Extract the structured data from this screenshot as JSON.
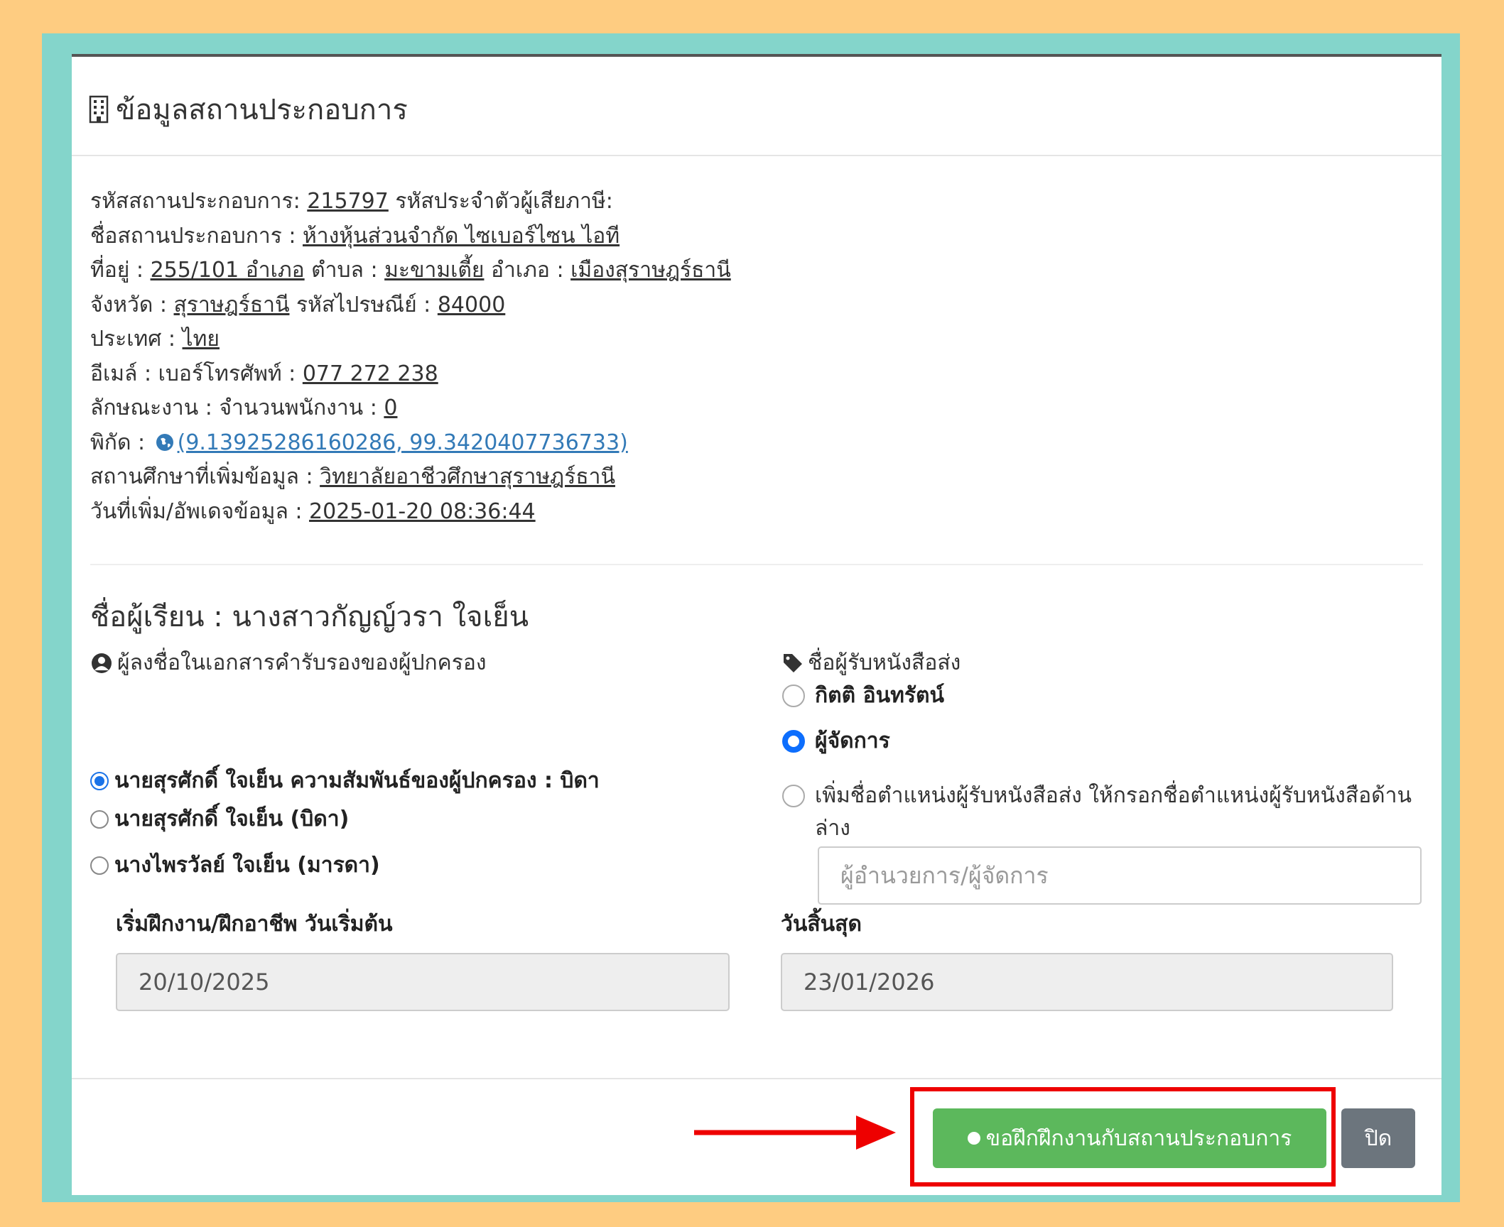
{
  "modal": {
    "title": "ข้อมูลสถานประกอบการ",
    "info": {
      "code_label": "รหัสสถานประกอบการ: ",
      "code_value": "215797",
      "tax_label": " รหัสประจำตัวผู้เสียภาษี:",
      "name_label": "ชื่อสถานประกอบการ : ",
      "name_value": "ห้างหุ้นส่วนจำกัด ไซเบอร์ไซน ไอที",
      "address_label": "ที่อยู่ : ",
      "address_value": "255/101 อำเภอ",
      "subdistrict_label": " ตำบล : ",
      "subdistrict_value": "มะขามเตี้ย",
      "district_label": " อำเภอ : ",
      "district_value": "เมืองสุราษฎร์ธานี",
      "province_label": "จังหวัด : ",
      "province_value": "สุราษฎร์ธานี",
      "postal_label": " รหัสไปรษณีย์ : ",
      "postal_value": "84000",
      "country_label": "ประเทศ : ",
      "country_value": "ไทย",
      "email_label": "อีเมล์ : ",
      "phone_label": "เบอร์โทรศัพท์ : ",
      "phone_value": "077 272 238",
      "nature_label": "ลักษณะงาน : ",
      "employees_label": "จำนวนพนักงาน : ",
      "employees_value": "0",
      "coords_label": "พิกัด : ",
      "coords_value": "(9.13925286160286, 99.3420407736733)",
      "school_label": "สถานศึกษาที่เพิ่มข้อมูล : ",
      "school_value": "วิทยาลัยอาชีวศึกษาสุราษฎร์ธานี",
      "updated_label": "วันที่เพิ่ม/อัพเดจข้อมูล : ",
      "updated_value": "2025-01-20 08:36:44"
    },
    "student": "ชื่อผู้เรียน : นางสาวกัญญ์วรา ใจเย็น",
    "guardian": {
      "label": "ผู้ลงชื่อในเอกสารคำรับรองของผู้ปกครอง",
      "options": [
        "นายสุรศักดิ์ ใจเย็น ความสัมพันธ์ของผู้ปกครอง : บิดา",
        "นายสุรศักดิ์ ใจเย็น (บิดา)",
        "นางไพรวัลย์ ใจเย็น (มารดา)"
      ],
      "selected": 0
    },
    "recipient": {
      "label": "ชื่อผู้รับหนังสือส่ง",
      "options": [
        "กิตติ อินทรัตน์",
        "ผู้จัดการ",
        "เพิ่มชื่อตำแหน่งผู้รับหนังสือส่ง ให้กรอกชื่อตำแหน่งผู้รับหนังสือด้านล่าง"
      ],
      "selected": 1,
      "placeholder": "ผู้อำนวยการ/ผู้จัดการ"
    },
    "start": {
      "label": "เริ่มฝึกงาน/ฝึกอาชีพ วันเริ่มต้น",
      "value": "20/10/2025"
    },
    "end": {
      "label": "วันสิ้นสุด",
      "value": "23/01/2026"
    },
    "buttons": {
      "submit": "ขอฝึกฝึกงานกับสถานประกอบการ",
      "close": "ปิด"
    }
  },
  "colors": {
    "page_bg": "#fecc81",
    "frame": "#84d5cb",
    "primary": "#5cb85c",
    "secondary": "#6c757d",
    "highlight": "#ee0000",
    "link": "#337ab7"
  }
}
